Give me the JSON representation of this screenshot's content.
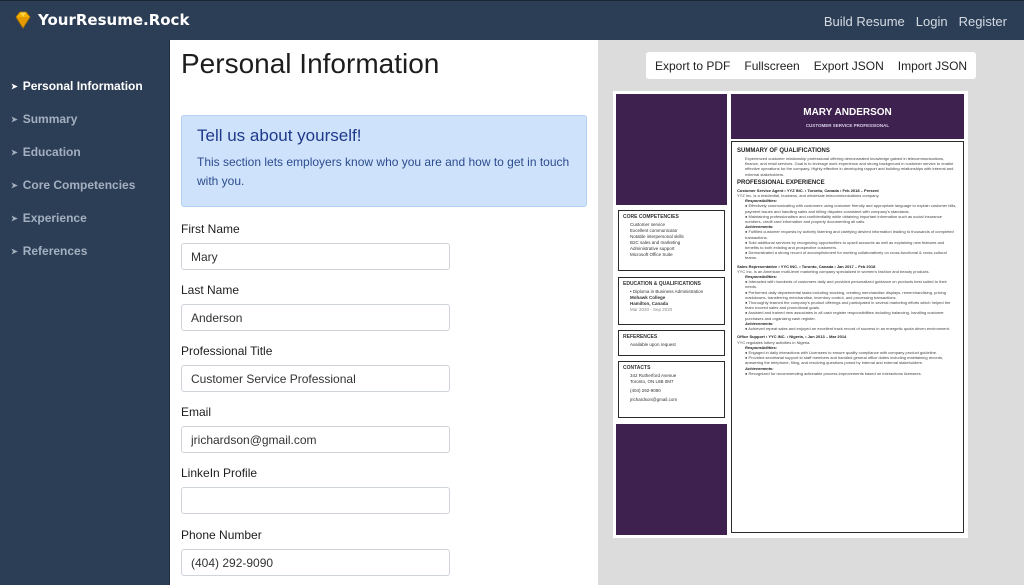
{
  "brand": {
    "name": "YourResume.Rock",
    "icon": "diamond-icon"
  },
  "nav": {
    "links": [
      "Build Resume",
      "Login",
      "Register"
    ]
  },
  "sidebar": {
    "items": [
      {
        "label": "Personal Information",
        "active": true
      },
      {
        "label": "Summary"
      },
      {
        "label": "Education"
      },
      {
        "label": "Core Competencies"
      },
      {
        "label": "Experience"
      },
      {
        "label": "References"
      }
    ]
  },
  "form": {
    "title": "Personal Information",
    "callout": {
      "title": "Tell us about yourself!",
      "text": "This section lets employers know who you are and how to get in touch with you."
    },
    "fields": [
      {
        "label": "First Name",
        "value": "Mary"
      },
      {
        "label": "Last Name",
        "value": "Anderson"
      },
      {
        "label": "Professional Title",
        "value": "Customer Service Professional"
      },
      {
        "label": "Email",
        "value": "jrichardson@gmail.com"
      },
      {
        "label": "LinkeIn Profile",
        "value": ""
      },
      {
        "label": "Phone Number",
        "value": "(404) 292-9090"
      }
    ]
  },
  "toolbar": {
    "buttons": [
      "Export to PDF",
      "Fullscreen",
      "Export JSON",
      "Import JSON"
    ]
  },
  "resume": {
    "name": "MARY ANDERSON",
    "title": "CUSTOMER SERVICE PROFESSIONAL",
    "accent": "#3f2150",
    "core": {
      "title": "CORE COMPETENCIES",
      "items": [
        "Customer service",
        "Excellent communicator",
        "Notable interpersonal skills",
        "B2C sales and marketing",
        "Administrative support",
        "Microsoft Office Suite"
      ]
    },
    "education": {
      "title": "EDUCATION & QUALIFICATIONS",
      "degree": "• Diploma in Business Administration",
      "school": "Mohawk College",
      "place": "Hamilton, Canada",
      "dates": "Mar 2020 - Sep 2020"
    },
    "references": {
      "title": "REFERENCES",
      "text": "Available upon request"
    },
    "contacts": {
      "title": "CONTACTS",
      "address1": "342 Rutherford Avenue",
      "address2": "Toronto, ON L6B 0M7",
      "phone": "(404) 292-9090",
      "email": "jrichardson@gmail.com"
    },
    "summary": {
      "title": "SUMMARY OF QUALIFICATIONS",
      "text": "Experienced customer relationship professional offering demonstrated knowledge gained in telecommunications, finance, and retail services. Goal is to leverage work experience and strong background in customer service to enable effective operations for the company. Highly effective in developing rapport and building relationships with internal and external stakeholders."
    },
    "experience": {
      "title": "PROFESSIONAL EXPERIENCE",
      "jobs": [
        {
          "heading": "Customer Service Agent • YYZ INC. • Toronto, Canada • Feb 2018 – Present",
          "company": "YYZ Inc. is a residential, business, and wholesale telecommunications company.",
          "resp_label": "Responsibilities:",
          "resp": [
            "● Effectively communicating with customers using customer friendly and appropriate language to explain customer bills, payment issues and handling sales and billing disputes consistent with company's standards.",
            "● Maintaining professionalism and confidentiality while obtaining important information such as social insurance numbers, credit card information and property documenting all calls."
          ],
          "ach_label": "Achievements:",
          "ach": [
            "● Fulfilled customer requests by actively listening and clarifying desired information leading to thousands of completed transactions.",
            "● Sold additional services by recognizing opportunities to upsell accounts as well as explaining new features and benefits to both existing and prospective customers.",
            "● Demonstrated a strong record of accomplishment for working collaboratively on cross-functional & cross-cultural teams."
          ]
        },
        {
          "heading": "Sales Representative • YYC INC. • Toronto, Canada • Jan 2017 – Feb 2018",
          "company": "YYC Inc. is an American multi-level marketing company specialized in women's fashion and beauty products.",
          "resp_label": "Responsibilities:",
          "resp": [
            "● Interacted with hundreds of customers daily and provided personalized guidance on products best suited to their needs.",
            "● Performed daily departmental tasks including stocking, creating merchandise displays, remerchandising, pricing markdowns, transferring merchandise, inventory control, and processing transactions.",
            "● Thoroughly learned the company's product offerings and participated in several marketing efforts which helped the team exceed sales and promotional goals.",
            "● Assisted and trained new associates in all cash register responsibilities including balancing, handling customer purchases and organizing cash register."
          ],
          "ach_label": "Achievements:",
          "ach": [
            "● Achieved repeat sales and enjoyed an excellent track record of success in an energetic quota driven environment."
          ]
        },
        {
          "heading": "Office Support • YYC INC. • Nigeria, • Jun 2013 – Mar 2014",
          "company": "YYC regulates lottery activities in Nigeria.",
          "resp_label": "Responsibilities:",
          "resp": [
            "● Engaged in daily interactions with Licensees to ensure quality compliance with company product guideline.",
            "● Provided secretarial support to staff members and handled general office duties including maintaining records, answering the telephone, filing, and resolving questions posed by internal and external stakeholders."
          ],
          "ach_label": "Achievements:",
          "ach": [
            "● Recognized for recommending actionable process improvements based on interactions licensees."
          ]
        }
      ]
    }
  }
}
